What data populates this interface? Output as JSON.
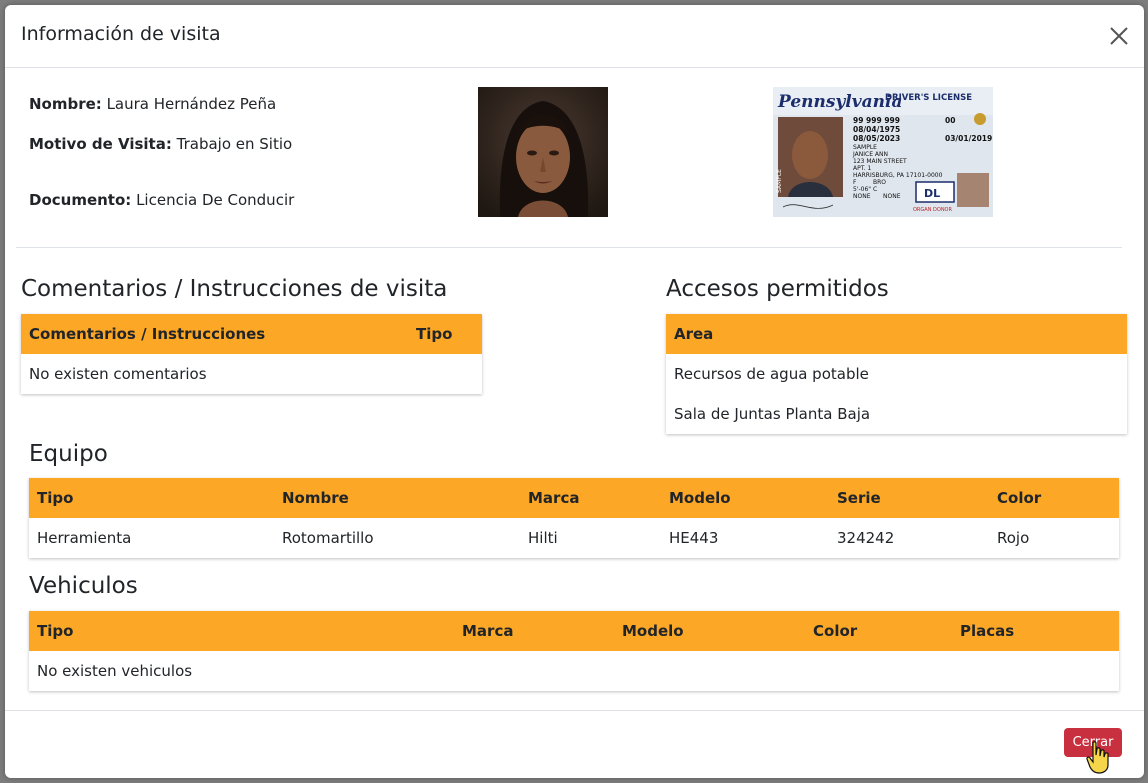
{
  "modal": {
    "title": "Información de visita",
    "close_label": "Cerrar"
  },
  "visitor": {
    "name_label": "Nombre:",
    "name": "Laura Hernández Peña",
    "reason_label": "Motivo de Visita:",
    "reason": "Trabajo en Sitio",
    "document_label": "Documento:",
    "document": "Licencia De Conducir"
  },
  "license_card": {
    "state": "Pennsylvania",
    "type": "DRIVER'S LICENSE",
    "dl_number": "99 999 999",
    "dob": "08/04/1975",
    "exp": "08/05/2023",
    "iss": "03/01/2019",
    "dups": "00",
    "name_line1": "SAMPLE",
    "name_line2": "JANICE ANN",
    "address1": "123 MAIN STREET",
    "address2": "APT. 1",
    "address3": "HARRISBURG, PA 17101-0000",
    "sex": "F",
    "eyes": "BRO",
    "height": "5'-06\"",
    "class": "C",
    "end": "NONE",
    "restr": "NONE",
    "badge": "DL",
    "donor": "ORGAN DONOR",
    "sample": "SAMPLE"
  },
  "comments": {
    "section_title": "Comentarios / Instrucciones de visita",
    "headers": [
      "Comentarios / Instrucciones",
      "Tipo"
    ],
    "empty_message": "No existen comentarios"
  },
  "access": {
    "section_title": "Accesos permitidos",
    "header": "Area",
    "rows": [
      "Recursos de agua potable",
      "Sala de Juntas Planta Baja"
    ]
  },
  "equipment": {
    "section_title": "Equipo",
    "headers": [
      "Tipo",
      "Nombre",
      "Marca",
      "Modelo",
      "Serie",
      "Color"
    ],
    "rows": [
      [
        "Herramienta",
        "Rotomartillo",
        "Hilti",
        "HE443",
        "324242",
        "Rojo"
      ]
    ]
  },
  "vehicles": {
    "section_title": "Vehiculos",
    "headers": [
      "Tipo",
      "Marca",
      "Modelo",
      "Color",
      "Placas"
    ],
    "empty_message": "No existen vehiculos"
  },
  "colors": {
    "table_header": "#fca726",
    "close_button": "#c8303f"
  }
}
